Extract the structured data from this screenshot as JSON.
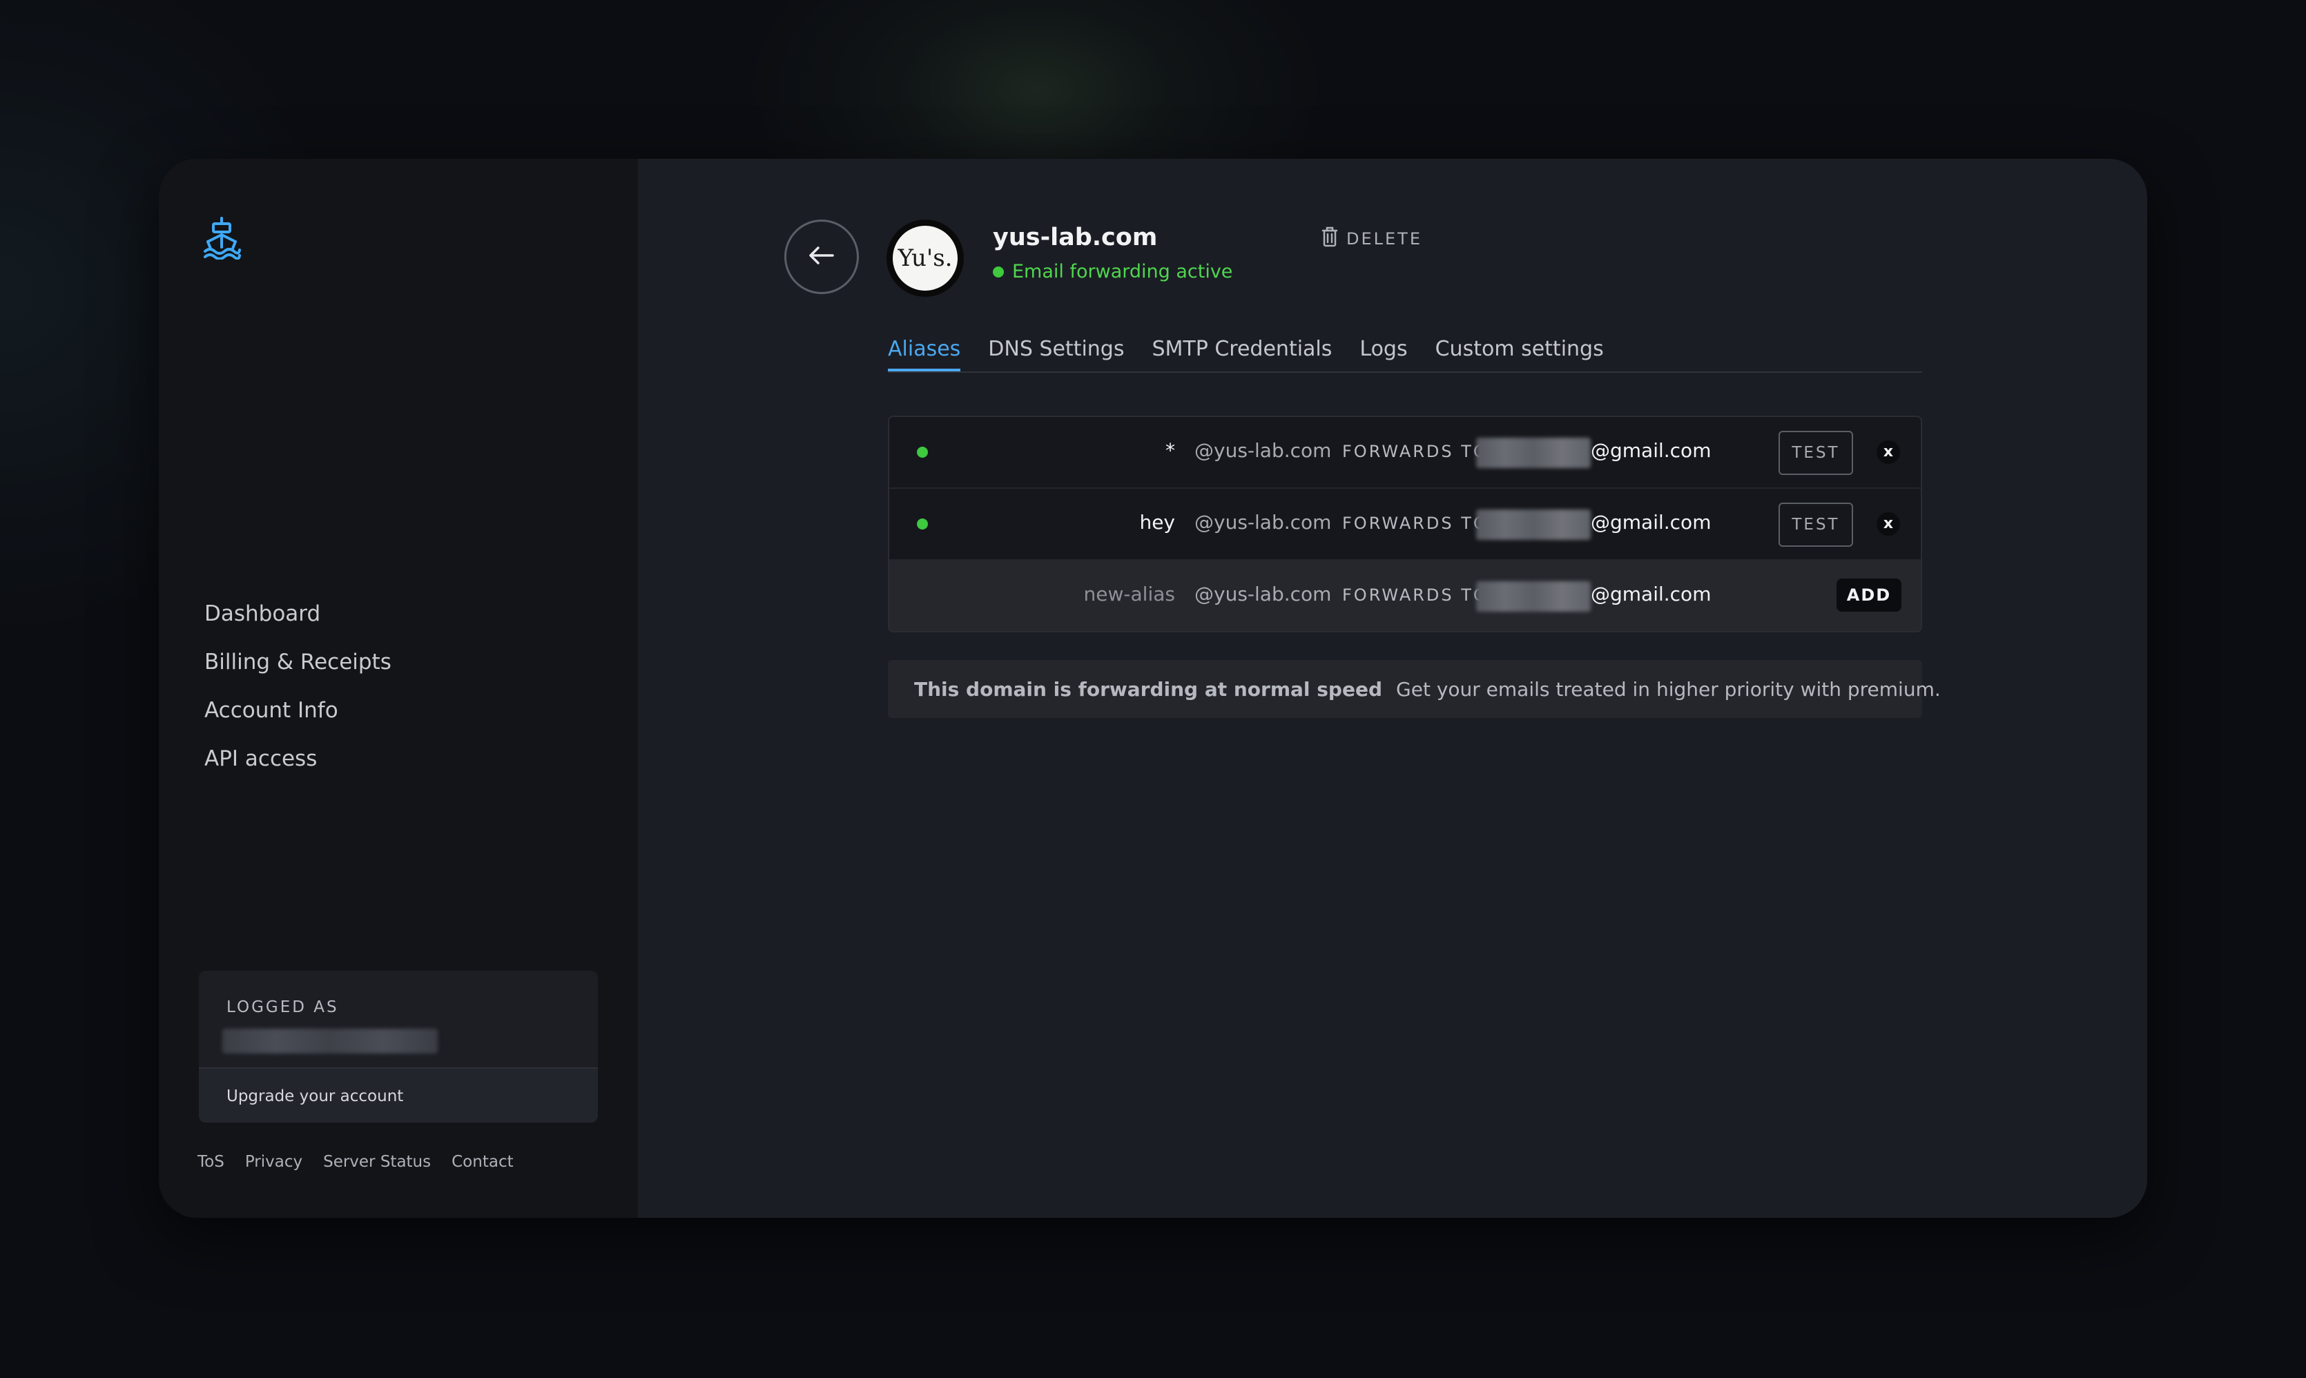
{
  "sidebar": {
    "logo_icon": "ship-icon",
    "logo_color": "#3fa9f5",
    "nav": [
      {
        "label": "Dashboard"
      },
      {
        "label": "Billing & Receipts"
      },
      {
        "label": "Account Info"
      },
      {
        "label": "API access"
      }
    ],
    "logged_as_label": "LOGGED AS",
    "upgrade_label": "Upgrade your account",
    "footer": [
      "ToS",
      "Privacy",
      "Server Status",
      "Contact"
    ]
  },
  "header": {
    "back_icon": "arrow-left-icon",
    "avatar_text": "Yu's.",
    "domain": "yus-lab.com",
    "delete_label": "DELETE",
    "delete_icon": "trash-icon",
    "status": "Email forwarding active",
    "status_color": "#4fd64f"
  },
  "tabs": [
    {
      "label": "Aliases",
      "active": true
    },
    {
      "label": "DNS Settings",
      "active": false
    },
    {
      "label": "SMTP Credentials",
      "active": false
    },
    {
      "label": "Logs",
      "active": false
    },
    {
      "label": "Custom settings",
      "active": false
    }
  ],
  "aliases": [
    {
      "name": "*",
      "domain": "@yus-lab.com",
      "forwards_label": "FORWARDS TO",
      "email_suffix": "@gmail.com",
      "test_label": "TEST",
      "remove_label": "x"
    },
    {
      "name": "hey",
      "domain": "@yus-lab.com",
      "forwards_label": "FORWARDS TO",
      "email_suffix": "@gmail.com",
      "test_label": "TEST",
      "remove_label": "x"
    }
  ],
  "new_alias": {
    "placeholder": "new-alias",
    "domain": "@yus-lab.com",
    "forwards_label": "FORWARDS TO",
    "email_suffix": "@gmail.com",
    "add_label": "ADD"
  },
  "notice": {
    "strong": "This domain is forwarding at normal speed",
    "text": "Get your emails treated in higher priority with premium."
  }
}
